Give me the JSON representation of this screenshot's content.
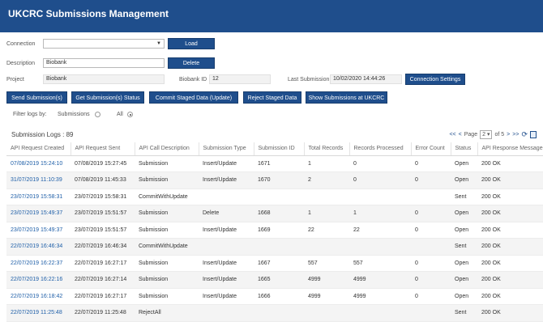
{
  "header": {
    "title": "UKCRC Submissions Management"
  },
  "connection": {
    "label": "Connection",
    "value": "",
    "load_label": "Load"
  },
  "description": {
    "label": "Description",
    "value": "Biobank",
    "delete_label": "Delete"
  },
  "project": {
    "label": "Project",
    "value": "Biobank"
  },
  "biobank_id": {
    "label": "Biobank ID",
    "value": "12"
  },
  "last_submission": {
    "label": "Last Submission",
    "value": "10/02/2020 14:44:26"
  },
  "connection_settings_label": "Connection Settings",
  "actions": {
    "send": "Send Submission(s)",
    "get_status": "Get Submission(s) Status",
    "commit": "Commit Staged Data (Update)",
    "reject": "Reject Staged Data",
    "show": "Show Submissions at UKCRC"
  },
  "filter": {
    "label": "Filter logs by:",
    "submissions": "Submissions",
    "all": "All",
    "selected": "all"
  },
  "logs": {
    "title": "Submission Logs : 89"
  },
  "pager": {
    "first": "<<",
    "prev": "<",
    "page_label": "Page",
    "page": "2",
    "of_label": "of 5",
    "next": ">",
    "last": ">>"
  },
  "table": {
    "columns": [
      "API Request Created",
      "API Request Sent",
      "API Call Description",
      "Submission Type",
      "Submission ID",
      "Total Records",
      "Records Processed",
      "Error Count",
      "Status",
      "API Response Message"
    ],
    "rows": [
      [
        "07/08/2019 15:24:10",
        "07/08/2019 15:27:45",
        "Submission",
        "Insert/Update",
        "1671",
        "1",
        "0",
        "0",
        "Open",
        "200 OK"
      ],
      [
        "31/07/2019 11:10:39",
        "07/08/2019 11:45:33",
        "Submission",
        "Insert/Update",
        "1670",
        "2",
        "0",
        "0",
        "Open",
        "200 OK"
      ],
      [
        "23/07/2019 15:58:31",
        "23/07/2019 15:58:31",
        "CommitWithUpdate",
        "",
        "",
        "",
        "",
        "",
        "Sent",
        "200 OK"
      ],
      [
        "23/07/2019 15:49:37",
        "23/07/2019 15:51:57",
        "Submission",
        "Delete",
        "1668",
        "1",
        "1",
        "0",
        "Open",
        "200 OK"
      ],
      [
        "23/07/2019 15:49:37",
        "23/07/2019 15:51:57",
        "Submission",
        "Insert/Update",
        "1669",
        "22",
        "22",
        "0",
        "Open",
        "200 OK"
      ],
      [
        "22/07/2019 16:46:34",
        "22/07/2019 16:46:34",
        "CommitWithUpdate",
        "",
        "",
        "",
        "",
        "",
        "Sent",
        "200 OK"
      ],
      [
        "22/07/2019 16:22:37",
        "22/07/2019 16:27:17",
        "Submission",
        "Insert/Update",
        "1667",
        "557",
        "557",
        "0",
        "Open",
        "200 OK"
      ],
      [
        "22/07/2019 16:22:16",
        "22/07/2019 16:27:14",
        "Submission",
        "Insert/Update",
        "1665",
        "4999",
        "4999",
        "0",
        "Open",
        "200 OK"
      ],
      [
        "22/07/2019 16:18:42",
        "22/07/2019 16:27:17",
        "Submission",
        "Insert/Update",
        "1666",
        "4999",
        "4999",
        "0",
        "Open",
        "200 OK"
      ],
      [
        "22/07/2019 11:25:48",
        "22/07/2019 11:25:48",
        "RejectAll",
        "",
        "",
        "",
        "",
        "",
        "Sent",
        "200 OK"
      ]
    ]
  }
}
